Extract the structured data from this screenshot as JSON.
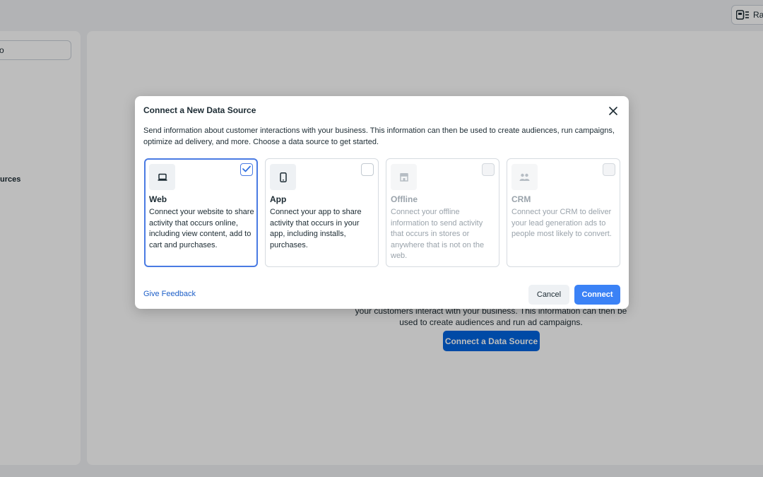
{
  "background": {
    "top_right_button_label": "Ra",
    "left_search_value": "o",
    "left_item_label": "urces",
    "description": "your customers interact with your business. This information can then be used to create audiences and run ad campaigns.",
    "connect_button_label": "Connect a Data Source"
  },
  "dialog": {
    "title": "Connect a New Data Source",
    "description": "Send information about customer interactions with your business. This information can then be used to create audiences, run campaigns, optimize ad delivery, and more. Choose a data source to get started.",
    "sources": [
      {
        "title": "Web",
        "description": "Connect your website to share activity that occurs online, including view content, add to cart and purchases.",
        "icon": "laptop-icon",
        "selected": true,
        "enabled": true
      },
      {
        "title": "App",
        "description": "Connect your app to share activity that occurs in your app, including installs, purchases.",
        "icon": "phone-icon",
        "selected": false,
        "enabled": true
      },
      {
        "title": "Offline",
        "description": "Connect your offline information to send activity that occurs in stores or anywhere that is not on the web.",
        "icon": "store-icon",
        "selected": false,
        "enabled": false
      },
      {
        "title": "CRM",
        "description": "Connect your CRM to deliver your lead generation ads to people most likely to convert.",
        "icon": "people-icon",
        "selected": false,
        "enabled": false
      }
    ],
    "feedback_label": "Give Feedback",
    "cancel_label": "Cancel",
    "connect_label": "Connect"
  },
  "colors": {
    "accent": "#3b82f6",
    "selected_border": "#4a7be3",
    "link": "#1d5fc8"
  }
}
